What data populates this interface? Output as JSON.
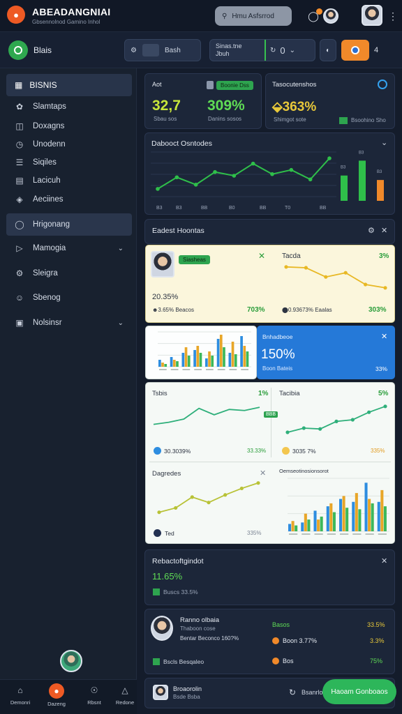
{
  "header": {
    "logo_icon": "fox-icon",
    "title": "ABEADANGNIAI",
    "subtitle": "Gbsennolnod Gamino Inhol",
    "search_label": "Hmu Asfsrrod",
    "notification_count_visible": true
  },
  "subbar": {
    "app_name": "Blais",
    "control_1": "Bash",
    "control_2_top": "Sinas.tne",
    "control_2_bottom": "Jbuh",
    "control_3_value": "0",
    "count": "4"
  },
  "sidebar": {
    "header": "BISNIS",
    "items": [
      {
        "label": "Slamtaps",
        "icon": "leaf-icon"
      },
      {
        "label": "Doxagns",
        "icon": "document-icon"
      },
      {
        "label": "Unodenn",
        "icon": "clock-icon"
      },
      {
        "label": "Siqiles",
        "icon": "list-icon"
      },
      {
        "label": "Lacicuh",
        "icon": "folder-icon"
      },
      {
        "label": "Aeciines",
        "icon": "shield-icon"
      },
      {
        "label": "Hrigonang",
        "icon": "tag-icon"
      },
      {
        "label": "Mamogia",
        "icon": "megaphone-icon"
      },
      {
        "label": "Sleigra",
        "icon": "gear-icon"
      },
      {
        "label": "Sbenog",
        "icon": "user-icon"
      },
      {
        "label": "Nolsinsr",
        "icon": "calendar-icon"
      }
    ]
  },
  "bottomnav": [
    {
      "label": "Demonri",
      "icon": "home-icon"
    },
    {
      "label": "Dazeng",
      "icon": "fox-icon"
    },
    {
      "label": "Rbsnt",
      "icon": "compass-icon"
    },
    {
      "label": "Redone",
      "icon": "flask-icon"
    }
  ],
  "kpi_left": {
    "title": "Aot",
    "pill": "Boonie Dss",
    "value_1": "32,7",
    "value_1_sub": "Sbau sos",
    "value_2": "309%",
    "value_2_sub": "Danins sosos"
  },
  "kpi_right": {
    "title": "Tasocutenshos",
    "value": "⬙363%",
    "value_sub": "Shimgot sote",
    "pill": "Bsoohino Sho"
  },
  "line_panel": {
    "title": "Dabooct Osntodes",
    "ticks": [
      "B3",
      "B3",
      "BB",
      "B0",
      "BB",
      "T0",
      "BB"
    ]
  },
  "cards_panel": {
    "title": "Eadest Hoontas"
  },
  "card_1": {
    "pill": "Siasheas",
    "value": "20.35%",
    "sub": "☻3.65% Beacos",
    "right_pct": "703%",
    "right_title": "Tacda",
    "right_pct2": "3%",
    "right_sub": "⬤0.93673% Eaalas",
    "right_pct3": "303%"
  },
  "card_2": {
    "title": "Bnhadbeoe",
    "value": "150%",
    "sub": "Boon Bateis",
    "right": "33%"
  },
  "card_3": {
    "left_title": "Tsbis",
    "left_pct": "1%",
    "left_value": "30.3039%",
    "left_right": "33.33%",
    "right_title": "Tacibia",
    "right_pct": "5%",
    "right_value": "3035 7%",
    "right_right": "335%",
    "badge": "BBB",
    "bl_title": "Dagredes",
    "bl_value": "Ted",
    "bl_right": "335%",
    "br_title": "Oemseotinosionsorot"
  },
  "bottom_panel_1": {
    "title": "Rebactoftgindot",
    "value": "11.65%",
    "sub": "Buscs 33.5%"
  },
  "bottom_panel_2": {
    "name": "Ranno olbaia",
    "role": "Thaboon cose",
    "detail": "Bentar Beconco 160?%",
    "r1_label": "Basos",
    "r1_value": "33.5%",
    "r2_label": "Boon 3.77%",
    "r2_value": "3.3%",
    "r3_label": "Bos",
    "r3_value": "75%",
    "footer": "Bscls Besqaleo"
  },
  "footer_bar": {
    "name": "Broaorolin",
    "sub": "Bsde Bsba",
    "action": "Bsanrlo"
  },
  "fab_label": "Haoam Gonboaos",
  "chart_data": [
    {
      "type": "line",
      "title": "Dabooct Osntodes",
      "x": [
        1,
        2,
        3,
        4,
        5,
        6,
        7,
        8,
        9,
        10
      ],
      "series": [
        {
          "values": [
            20,
            42,
            28,
            52,
            45,
            68,
            48,
            56,
            38,
            78
          ]
        }
      ],
      "bars": [
        {
          "values": [
            34,
            54,
            28
          ]
        }
      ]
    },
    {
      "type": "line",
      "title": "Tacda",
      "series": [
        {
          "values": [
            72,
            70,
            48,
            58,
            30,
            22
          ]
        }
      ]
    },
    {
      "type": "bar",
      "title": "Bnhadbeoe",
      "categories": [
        "a",
        "b",
        "c",
        "d",
        "e",
        "f",
        "g",
        "h"
      ],
      "series": [
        {
          "values": [
            10,
            14,
            20,
            24,
            12,
            40,
            20,
            44
          ]
        },
        {
          "values": [
            6,
            10,
            28,
            30,
            22,
            46,
            36,
            30
          ]
        },
        {
          "values": [
            4,
            8,
            16,
            20,
            16,
            28,
            18,
            22
          ]
        }
      ]
    },
    {
      "type": "line",
      "title": "Tsbis",
      "series": [
        {
          "values": [
            20,
            24,
            30,
            50,
            38,
            48,
            46,
            52
          ]
        }
      ]
    },
    {
      "type": "line",
      "title": "Tacibia",
      "series": [
        {
          "values": [
            10,
            20,
            18,
            36,
            40,
            58,
            72
          ]
        }
      ]
    },
    {
      "type": "line",
      "title": "Dagredes",
      "series": [
        {
          "values": [
            12,
            20,
            40,
            30,
            44,
            56,
            66
          ]
        }
      ]
    },
    {
      "type": "bar",
      "title": "Oemseotinosionsorot",
      "categories": [
        "a",
        "b",
        "c",
        "d",
        "e",
        "f",
        "g",
        "h"
      ],
      "series": [
        {
          "values": [
            10,
            12,
            28,
            34,
            44,
            40,
            66,
            40
          ]
        },
        {
          "values": [
            14,
            24,
            16,
            38,
            48,
            52,
            44,
            56
          ]
        },
        {
          "values": [
            8,
            16,
            20,
            26,
            32,
            30,
            38,
            34
          ]
        }
      ]
    }
  ],
  "colors": {
    "accent_green": "#2db65a",
    "accent_orange": "#f0892a",
    "accent_blue": "#2579d8",
    "bg": "#141c2b"
  }
}
